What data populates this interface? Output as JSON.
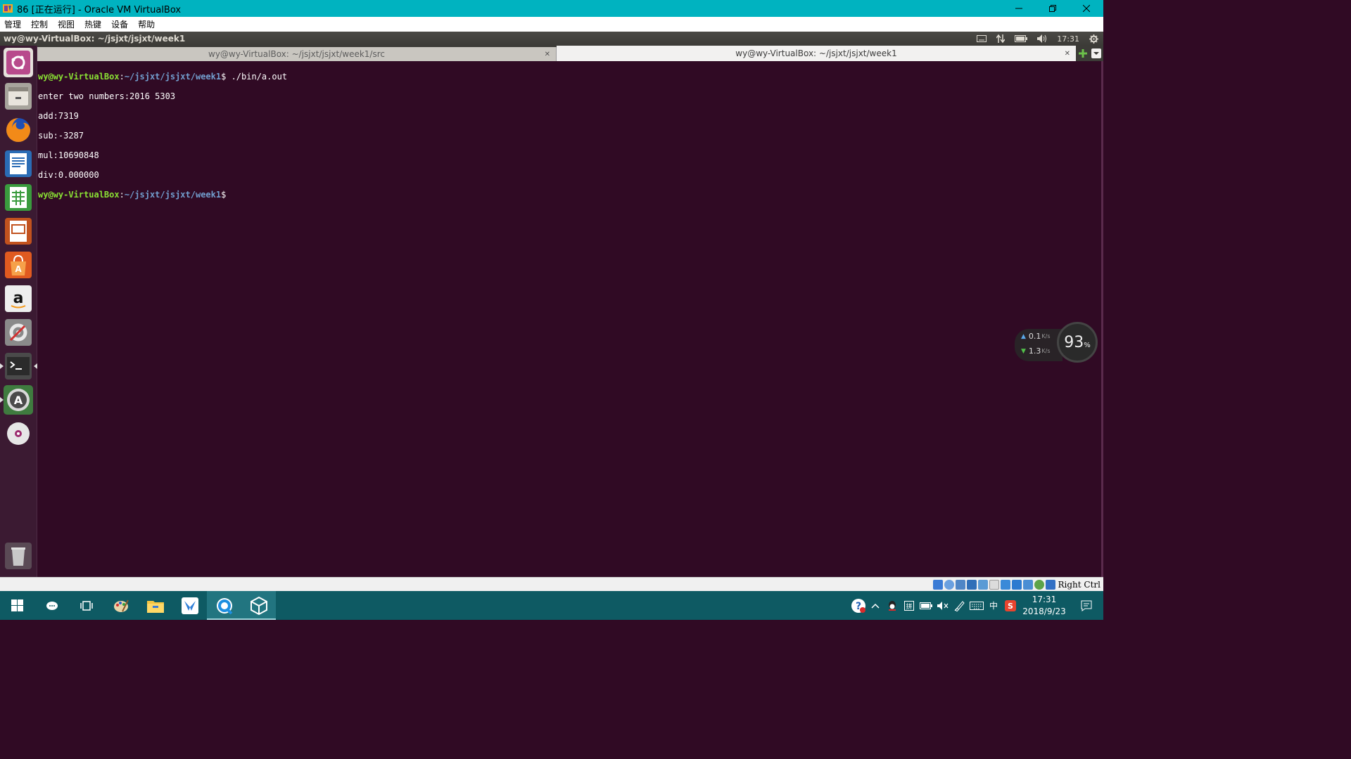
{
  "host_window": {
    "title": "86 [正在运行] - Oracle VM VirtualBox",
    "menu": [
      "管理",
      "控制",
      "视图",
      "热键",
      "设备",
      "帮助"
    ]
  },
  "ubuntu_panel": {
    "window_title": "wy@wy-VirtualBox: ~/jsjxt/jsjxt/week1",
    "time": "17:31"
  },
  "launcher": {
    "items": [
      "ubuntu-dash",
      "files",
      "firefox",
      "libreoffice-writer",
      "libreoffice-calc",
      "libreoffice-impress",
      "ubuntu-software",
      "amazon",
      "system-settings",
      "terminal",
      "software-updater",
      "dvd"
    ],
    "trash": "trash"
  },
  "tabs": [
    {
      "label": "wy@wy-VirtualBox: ~/jsjxt/jsjxt/week1/src",
      "active": false
    },
    {
      "label": "wy@wy-VirtualBox: ~/jsjxt/jsjxt/week1",
      "active": true
    }
  ],
  "terminal": {
    "user_host": "wy@wy-VirtualBox",
    "cwd": "~/jsjxt/jsjxt/week1",
    "command": " ./bin/a.out",
    "output": [
      "enter two numbers:2016 5303",
      "add:7319",
      "sub:-3287",
      "mul:10690848",
      "div:0.000000"
    ]
  },
  "netmon": {
    "upload": "0.1",
    "download": "1.3",
    "unit": "K/s",
    "percent": "93",
    "percent_sign": "%"
  },
  "statusbar": {
    "host_key": "Right Ctrl"
  },
  "taskbar": {
    "time": "17:31",
    "date": "2018/9/23",
    "ime": "中"
  }
}
